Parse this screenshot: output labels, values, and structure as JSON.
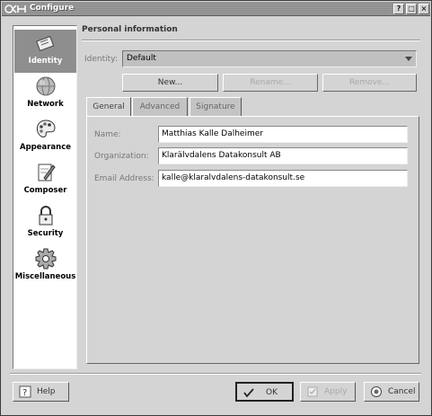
{
  "window": {
    "title": "Configure"
  },
  "titlebar_buttons": [
    "?",
    "□",
    "×"
  ],
  "sidebar": {
    "items": [
      {
        "label": "Identity",
        "icon": "identity-card-icon",
        "selected": true
      },
      {
        "label": "Network",
        "icon": "globe-icon",
        "selected": false
      },
      {
        "label": "Appearance",
        "icon": "palette-icon",
        "selected": false
      },
      {
        "label": "Composer",
        "icon": "pencil-paper-icon",
        "selected": false
      },
      {
        "label": "Security",
        "icon": "padlock-icon",
        "selected": false
      },
      {
        "label": "Miscellaneous",
        "icon": "gear-icon",
        "selected": false
      }
    ]
  },
  "main": {
    "section_title": "Personal information",
    "identity_label": "Identity:",
    "identity_value": "Default",
    "buttons": {
      "new": "New...",
      "rename": "Rename...",
      "remove": "Remove..."
    },
    "tabs": [
      "General",
      "Advanced",
      "Signature"
    ],
    "fields": [
      {
        "label": "Name:",
        "value": "Matthias Kalle Dalheimer"
      },
      {
        "label": "Organization:",
        "value": "Klarälvdalens Datakonsult AB"
      },
      {
        "label": "Email Address:",
        "value": "kalle@klaralvdalens-datakonsult.se"
      }
    ]
  },
  "footer": {
    "help": "Help",
    "ok": "OK",
    "apply": "Apply",
    "cancel": "Cancel"
  }
}
